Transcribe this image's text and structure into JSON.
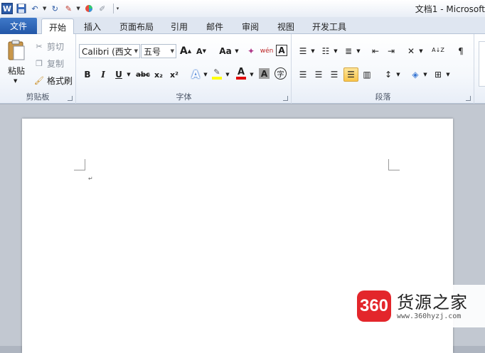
{
  "titlebar": {
    "title": "文档1 - Microsoft",
    "logo_letter": "W"
  },
  "tabs": {
    "file": "文件",
    "items": [
      "开始",
      "插入",
      "页面布局",
      "引用",
      "邮件",
      "审阅",
      "视图",
      "开发工具"
    ]
  },
  "clipboard": {
    "paste": "粘贴",
    "cut": "剪切",
    "copy": "复制",
    "format_painter": "格式刷",
    "label": "剪贴板"
  },
  "font": {
    "family": "Calibri (西文",
    "size": "五号",
    "label": "字体",
    "grow": "A",
    "shrink": "A",
    "change_case": "Aa",
    "pinyin": "wén",
    "char_border": "A",
    "bold": "B",
    "italic": "I",
    "underline": "U",
    "strike": "abc",
    "subscript": "x₂",
    "superscript": "x²",
    "effects": "A",
    "font_color": "A",
    "shading": "A",
    "enclose": "字"
  },
  "paragraph": {
    "label": "段落",
    "sort": "A↓Z"
  },
  "watermark": {
    "logo": "360",
    "name": "货源之家",
    "url": "www.360hyzj.com"
  }
}
